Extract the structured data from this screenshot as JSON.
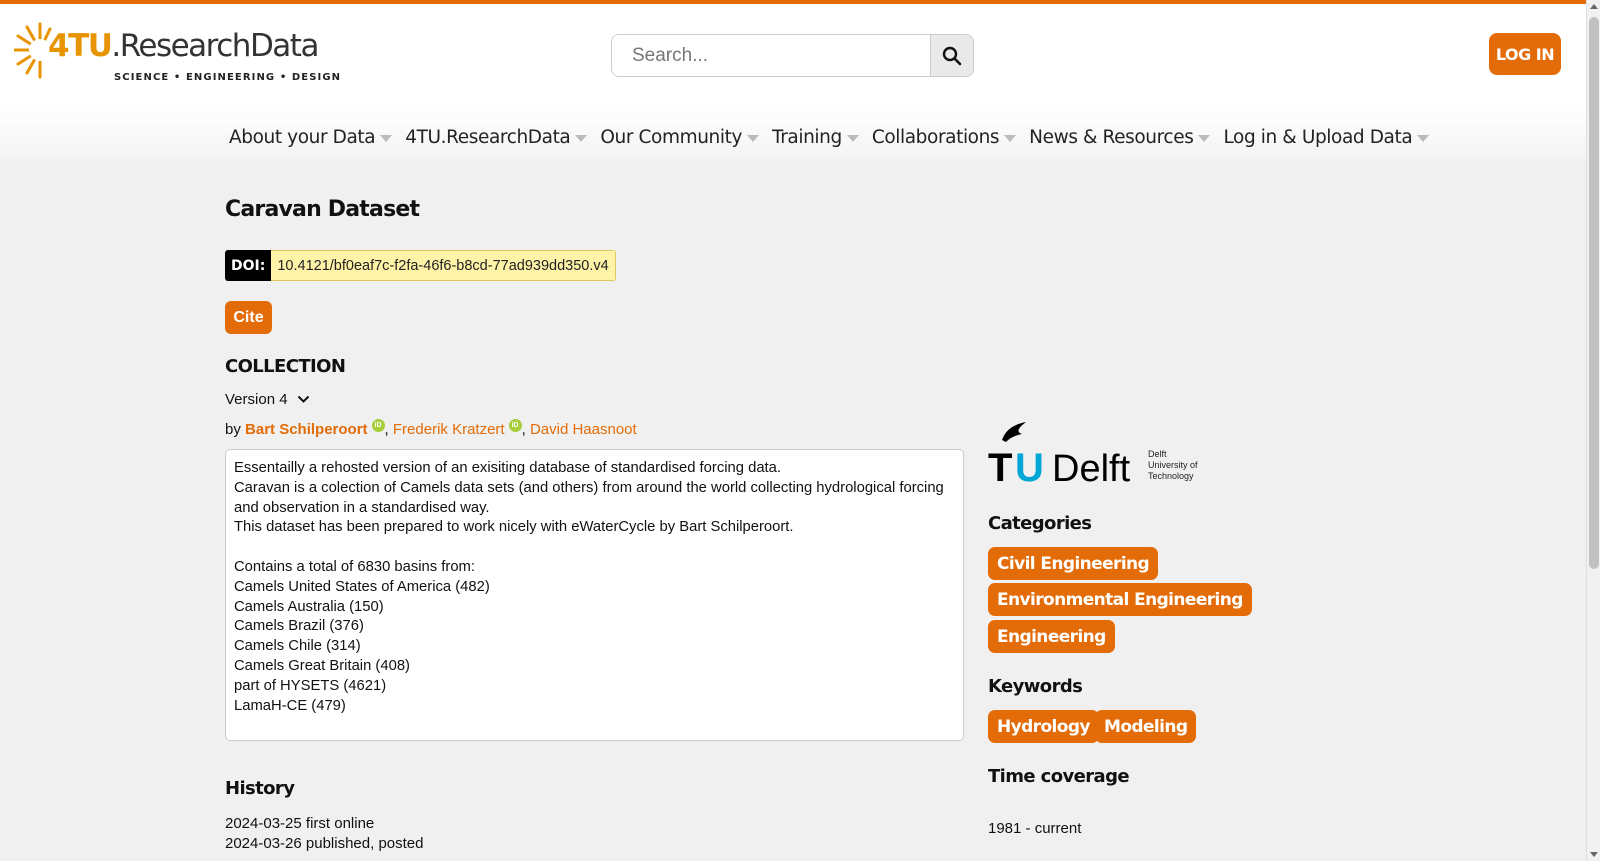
{
  "header": {
    "logo_main": "4TU",
    "logo_sub": ".ResearchData",
    "logo_tagline": "SCIENCE • ENGINEERING • DESIGN",
    "search_placeholder": "Search...",
    "login_label": "LOG IN"
  },
  "nav": {
    "items": [
      {
        "label": "About your Data"
      },
      {
        "label": "4TU.ResearchData"
      },
      {
        "label": "Our Community"
      },
      {
        "label": "Training"
      },
      {
        "label": "Collaborations"
      },
      {
        "label": "News & Resources"
      },
      {
        "label": "Log in & Upload Data"
      }
    ]
  },
  "dataset": {
    "title": "Caravan Dataset",
    "doi_label": "DOI:",
    "doi": "10.4121/bf0eaf7c-f2fa-46f6-b8cd-77ad939dd350.v4",
    "cite_label": "Cite",
    "type": "COLLECTION",
    "version": "Version 4",
    "by": "by",
    "authors": [
      "Bart Schilperoort",
      "Frederik Kratzert",
      "David Haasnoot"
    ],
    "description_lines": [
      "Essentailly a rehosted version of an exisiting database of standardised forcing data.",
      "Caravan is a colection of Camels data sets (and others) from around the world collecting hydrological forcing",
      "and observation in a standardised way.",
      "This dataset has been prepared to work nicely with eWaterCycle by Bart Schilperoort.",
      "",
      "Contains a total of 6830 basins from:",
      "Camels United States of America (482)",
      "Camels Australia (150)",
      "Camels Brazil (376)",
      "Camels Chile (314)",
      "Camels Great Britain (408)",
      "part of HYSETS (4621)",
      "LamaH-CE (479)"
    ],
    "history_heading": "History",
    "history": [
      "2024-03-25 first online",
      "2024-03-26 published, posted"
    ]
  },
  "sidebar": {
    "institution_logo": {
      "tu": "TU",
      "delft": "Delft",
      "small_lines": [
        "Delft",
        "University of",
        "Technology"
      ]
    },
    "categories_heading": "Categories",
    "categories": [
      "Civil Engineering",
      "Environmental Engineering",
      "Engineering"
    ],
    "keywords_heading": "Keywords",
    "keywords": [
      "Hydrology",
      "Modeling"
    ],
    "time_coverage_heading": "Time coverage",
    "time_coverage": "1981 - current"
  },
  "colors": {
    "accent": "#e36c09",
    "doi_bg": "#fff3a8",
    "orcid": "#a6ce39"
  }
}
